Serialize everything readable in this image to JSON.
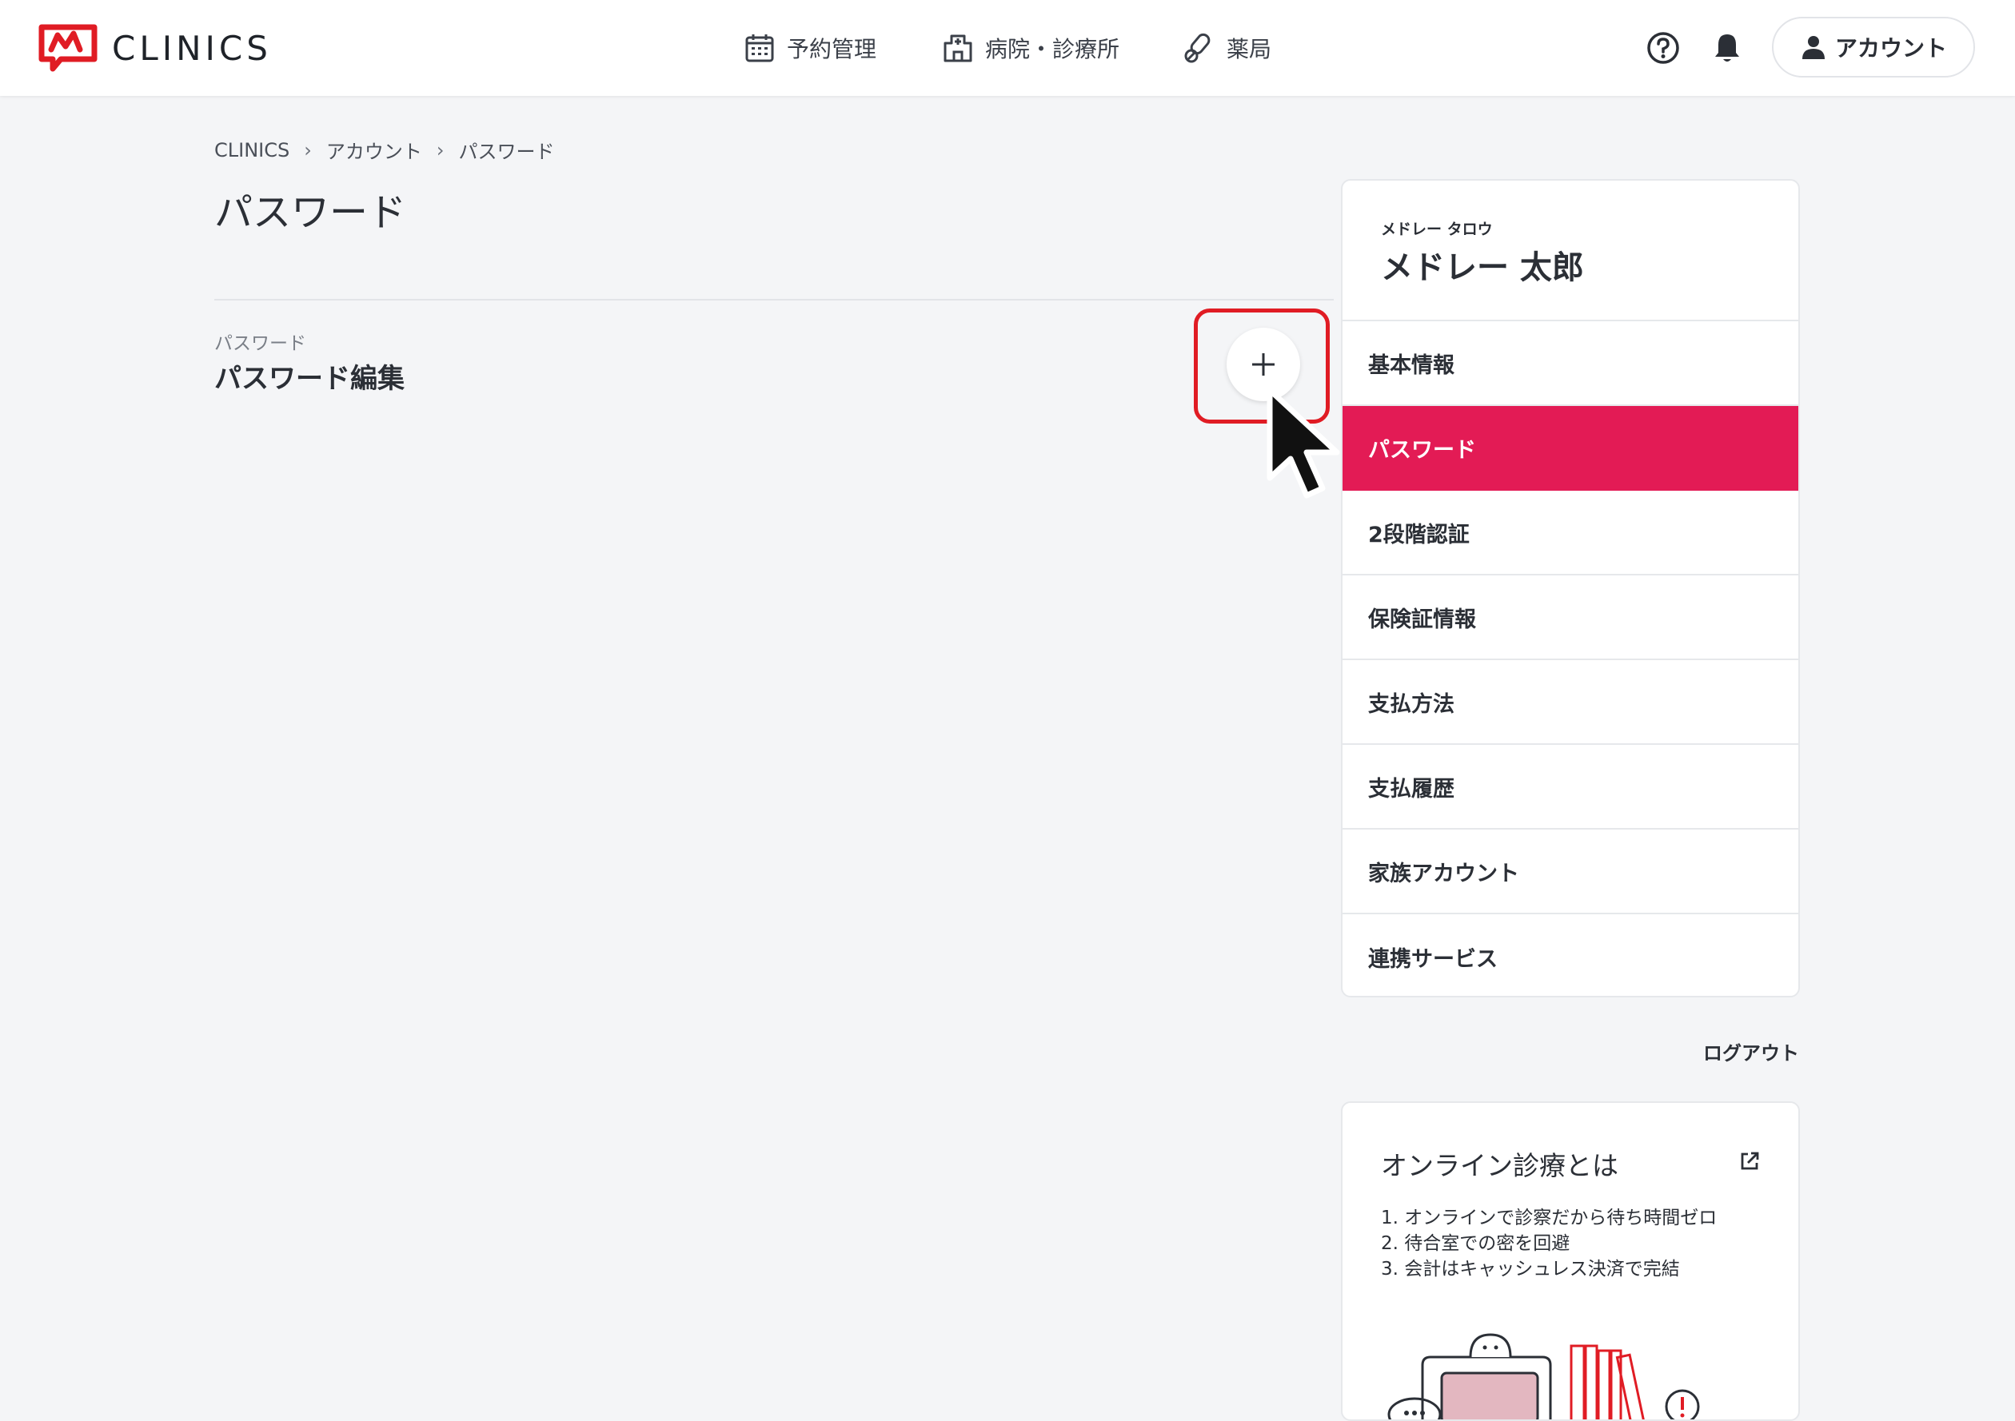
{
  "header": {
    "logo_text": "CLINICS",
    "brand_color": "#e01c24",
    "nav": [
      {
        "label": "予約管理",
        "icon": "calendar-icon"
      },
      {
        "label": "病院・診療所",
        "icon": "hospital-icon"
      },
      {
        "label": "薬局",
        "icon": "pharmacy-pill-icon"
      }
    ],
    "help_icon": "help-circle-icon",
    "notification_icon": "bell-icon",
    "account_label": "アカウント",
    "account_icon": "person-icon"
  },
  "breadcrumb": [
    "CLINICS",
    "アカウント",
    "パスワード"
  ],
  "page_title": "パスワード",
  "section": {
    "label": "パスワード",
    "title": "パスワード編集",
    "expand_icon": "plus-icon"
  },
  "side_menu": {
    "kana": "メドレー タロウ",
    "name": "メドレー 太郎",
    "items": [
      {
        "label": "基本情報"
      },
      {
        "label": "パスワード",
        "active": true
      },
      {
        "label": "2段階認証"
      },
      {
        "label": "保険証情報"
      },
      {
        "label": "支払方法"
      },
      {
        "label": "支払履歴"
      },
      {
        "label": "家族アカウント"
      },
      {
        "label": "連携サービス"
      }
    ],
    "active_color": "#e31b55"
  },
  "logout_label": "ログアウト",
  "info_card": {
    "title": "オンライン診療とは",
    "icon": "external-link-icon",
    "list": [
      "1. オンラインで診察だから待ち時間ゼロ",
      "2. 待合室での密を回避",
      "3. 会計はキャッシュレス決済で完結"
    ]
  },
  "annotation": {
    "highlight_color": "#e01c24",
    "cursor_icon": "mouse-pointer-icon"
  }
}
